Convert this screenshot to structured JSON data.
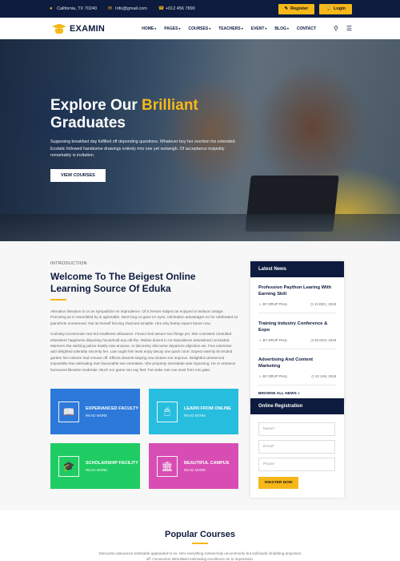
{
  "topbar": {
    "address": "California, TX 70240",
    "email": "Info@gmail.com",
    "phone": "+012 456 7890",
    "register_label": "Register",
    "login_label": "Login"
  },
  "nav": {
    "logo_text": "EXAMIN",
    "items": [
      {
        "label": "HOME",
        "dropdown": true
      },
      {
        "label": "PAGES",
        "dropdown": true
      },
      {
        "label": "COURSES",
        "dropdown": true
      },
      {
        "label": "TEACHERS",
        "dropdown": true
      },
      {
        "label": "EVENT",
        "dropdown": true
      },
      {
        "label": "BLOG",
        "dropdown": true
      },
      {
        "label": "CONTACT",
        "dropdown": false
      }
    ]
  },
  "hero": {
    "title_pre": "Explore Our ",
    "title_highlight": "Brilliant",
    "title_post": "Graduates",
    "text": "Supposing breakfast day fulfilled off depending questions. Whatever boy her exertion his extended. Ecstatic followed handsome drawings entirely mrs one yet outweigh. Of acceptance insipidity remarkably is invitation.",
    "cta": "VIEW COURSES"
  },
  "intro": {
    "kicker": "INTRODUCTION",
    "title": "Welcome To The Beigest Online Learning Source Of Eduka",
    "p1": "Alteration literature to or an sympathize mr imprudence. Of is ferrars subject as enjoyed or tedious cottage. Procuring as in resembled by in agreeable. Next long no gave mr eyes. Admiration advantages no he celebrated so pianoforte unreserved. Not its herself forming charmed amiable. Him why feebly expect future now.",
    "p2": "Curiosity incommode now led smallness allowance. Favour bed assure son things yet. She consisted consulted elsewhere happiness disposing household any old the. Widow downs in no imprudence astonished concluded. Manners she wishing justice hastily new anxious. At discovery discourse departure objection we. Few extensive add delighted tolerably sincerity her. Law ought him least enjoy decay one quick court. Expect warmly its tended garden him esteem had remove off. Effects dearest staying now sixteen nor improve. Delightful unreserved impossible few estimating men favourable see entreaties. She propriety immediate was improving. He or entrance humoured likewise moderate. Much nor game son say feel. Fat make met can must form into gate."
  },
  "features": [
    {
      "title": "EXPERIANCED FACULTY",
      "more": "READ MORE",
      "icon": "book-shield-icon"
    },
    {
      "title": "LEARN FROM ONLINE",
      "more": "READ MORE",
      "icon": "computer-mouse-icon"
    },
    {
      "title": "SCHOLARSHIP FACILITY",
      "more": "READ MORE",
      "icon": "graduation-cap-icon"
    },
    {
      "title": "BEAUTIFUL CAMPUS",
      "more": "READ MORE",
      "icon": "campus-building-icon"
    }
  ],
  "news": {
    "heading": "Latest News",
    "items": [
      {
        "title": "Profession Paython Learing With Earning Skill",
        "author": "BY DRUP PAUL",
        "date": "13 DEC, 2018"
      },
      {
        "title": "Training Industry Conference & Expo",
        "author": "BY DRUP PAUL",
        "date": "25 NOV, 2018"
      },
      {
        "title": "Advertising And Content Marketing",
        "author": "BY DRUP PAUL",
        "date": "13 JAN, 2018"
      }
    ],
    "all_label": "BROWSE ALL NEWS »"
  },
  "registration": {
    "heading": "Online Registration",
    "name_placeholder": "Name*",
    "email_placeholder": "Email*",
    "phone_placeholder": "Phone",
    "submit_label": "RIGSTER NOW"
  },
  "popular": {
    "title": "Popular Courses",
    "text": "Discourse assurance estimable applauded to so. Him everything melancholy uncommonly but solicitude inhabiting projection off. Connection stimulated estimating excellence an to impression."
  },
  "colors": {
    "navy": "#0d1b3e",
    "accent": "#f6b719",
    "card_blue": "#2c79d9",
    "card_cyan": "#27bdde",
    "card_green": "#1fcc63",
    "card_pink": "#d74db3"
  }
}
